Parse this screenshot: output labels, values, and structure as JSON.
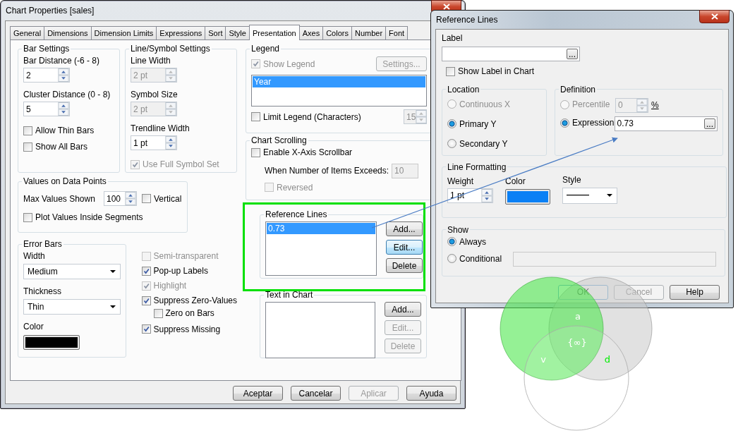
{
  "main_window": {
    "title": "Chart Properties [sales]"
  },
  "tabs": [
    {
      "label": "General",
      "selected": false
    },
    {
      "label": "Dimensions",
      "selected": false
    },
    {
      "label": "Dimension Limits",
      "selected": false
    },
    {
      "label": "Expressions",
      "selected": false
    },
    {
      "label": "Sort",
      "selected": false
    },
    {
      "label": "Style",
      "selected": false
    },
    {
      "label": "Presentation",
      "selected": true
    },
    {
      "label": "Axes",
      "selected": false
    },
    {
      "label": "Colors",
      "selected": false
    },
    {
      "label": "Number",
      "selected": false
    },
    {
      "label": "Font",
      "selected": false
    }
  ],
  "bar_settings": {
    "title": "Bar Settings",
    "bar_distance": {
      "label": "Bar Distance (-6 - 8)",
      "value": "2"
    },
    "cluster_distance": {
      "label": "Cluster Distance (0 - 8)",
      "value": "5"
    },
    "checkboxes": [
      {
        "label": "Allow Thin Bars",
        "checked": false
      },
      {
        "label": "Show All Bars",
        "checked": false
      }
    ]
  },
  "line_symbol_settings": {
    "title": "Line/Symbol Settings",
    "fields": [
      {
        "label": "Line Width",
        "value": "2 pt",
        "disabled": true
      },
      {
        "label": "Symbol Size",
        "value": "2 pt",
        "disabled": true
      },
      {
        "label": "Trendline Width",
        "value": "1 pt",
        "disabled": false
      }
    ],
    "use_full_symbol_set": {
      "label": "Use Full Symbol Set",
      "checked": true,
      "disabled": true
    }
  },
  "values_on_data_points": {
    "title": "Values on Data Points",
    "max_values": {
      "label": "Max Values Shown",
      "value": "100"
    },
    "vertical": {
      "label": "Vertical",
      "checked": false
    },
    "plot_inside": {
      "label": "Plot Values Inside Segments",
      "checked": false
    }
  },
  "error_bars": {
    "title": "Error Bars",
    "width": {
      "label": "Width",
      "value": "Medium"
    },
    "thickness": {
      "label": "Thickness",
      "value": "Thin"
    },
    "color": {
      "label": "Color",
      "color": "#000000"
    }
  },
  "options": [
    {
      "label": "Semi-transparent",
      "checked": false,
      "disabled": true
    },
    {
      "label": "Pop-up Labels",
      "checked": true,
      "disabled": false
    },
    {
      "label": "Highlight",
      "checked": true,
      "disabled": true
    },
    {
      "label": "Suppress Zero-Values",
      "checked": true,
      "disabled": false,
      "children": [
        {
          "label": "Zero on Bars",
          "checked": false
        }
      ]
    },
    {
      "label": "Suppress Missing",
      "checked": true,
      "disabled": false
    }
  ],
  "legend": {
    "title": "Legend",
    "show_legend": {
      "label": "Show Legend",
      "checked": true,
      "disabled": true
    },
    "settings_button": {
      "label": "Settings...",
      "disabled": true
    },
    "items": [
      {
        "label": "Year",
        "selected": true
      }
    ],
    "limit_legend": {
      "label": "Limit Legend (Characters)",
      "checked": false
    },
    "limit_value": {
      "value": "15",
      "disabled": true
    }
  },
  "chart_scrolling": {
    "title": "Chart Scrolling",
    "enable_scrollbar": {
      "label": "Enable X-Axis Scrollbar",
      "checked": false
    },
    "items_exceeds": {
      "label": "When Number of Items Exceeds:",
      "value": "10"
    },
    "reversed": {
      "label": "Reversed",
      "checked": false,
      "disabled": true
    }
  },
  "reference_lines": {
    "title": "Reference Lines",
    "items": [
      {
        "label": "0.73",
        "selected": true
      }
    ],
    "buttons": [
      {
        "label": "Add...",
        "focused": false
      },
      {
        "label": "Edit...",
        "focused": true
      },
      {
        "label": "Delete",
        "focused": false
      }
    ]
  },
  "text_in_chart": {
    "title": "Text in Chart",
    "buttons": [
      {
        "label": "Add...",
        "disabled": false
      },
      {
        "label": "Edit...",
        "disabled": true
      },
      {
        "label": "Delete",
        "disabled": true
      }
    ]
  },
  "dialog_buttons": [
    {
      "label": "Aceptar",
      "disabled": false
    },
    {
      "label": "Cancelar",
      "disabled": false
    },
    {
      "label": "Aplicar",
      "disabled": true
    },
    {
      "label": "Ayuda",
      "disabled": false
    }
  ],
  "reference_dialog": {
    "title": "Reference Lines",
    "label_field": {
      "label": "Label",
      "browse": "..."
    },
    "show_label": {
      "label": "Show Label in Chart",
      "checked": false
    },
    "location": {
      "title": "Location",
      "options": [
        {
          "label": "Continuous X",
          "selected": false,
          "disabled": true
        },
        {
          "label": "Primary Y",
          "selected": true,
          "disabled": false
        },
        {
          "label": "Secondary Y",
          "selected": false,
          "disabled": false
        }
      ]
    },
    "definition": {
      "title": "Definition",
      "percentile": {
        "label": "Percentile",
        "selected": false,
        "disabled": true,
        "value": "0",
        "unit": "%"
      },
      "expression": {
        "label": "Expression",
        "selected": true,
        "disabled": false,
        "value": "0.73",
        "browse": "..."
      }
    },
    "line_formatting": {
      "title": "Line Formatting",
      "weight": {
        "label": "Weight",
        "value": "1 pt"
      },
      "color": {
        "label": "Color",
        "color": "#0a80f5"
      },
      "style": {
        "label": "Style"
      }
    },
    "show": {
      "title": "Show",
      "options": [
        {
          "label": "Always",
          "selected": true
        },
        {
          "label": "Conditional",
          "selected": false
        }
      ]
    },
    "buttons": [
      {
        "label": "OK",
        "disabled": true,
        "focused": true
      },
      {
        "label": "Cancel",
        "disabled": true,
        "focused": false
      },
      {
        "label": "Help",
        "disabled": false,
        "focused": false
      }
    ]
  },
  "venn_labels": [
    {
      "text": "a",
      "color": "#ffffff"
    },
    {
      "text": "{∞}",
      "color": "#ffffff"
    },
    {
      "text": "v",
      "color": "#ffffff"
    },
    {
      "text": "d",
      "color": "#00ee00"
    }
  ]
}
